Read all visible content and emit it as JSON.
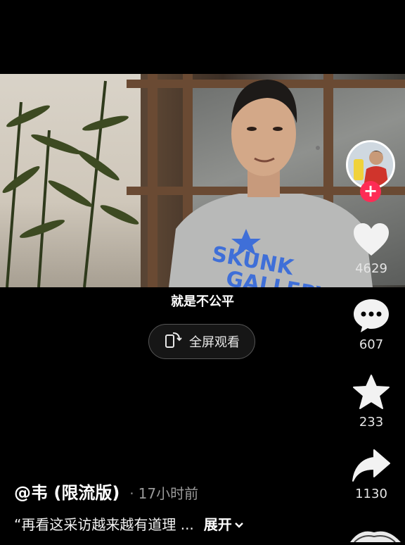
{
  "video": {
    "subtitle": "就是不公平"
  },
  "fullscreen": {
    "label": "全屏观看"
  },
  "actions": {
    "likes": "4629",
    "comments": "607",
    "favorites": "233",
    "shares": "1130"
  },
  "post": {
    "author": "@韦 (限流版)",
    "separator": "·",
    "time": "17小时前",
    "caption": "“再看这采访越来越有道理 ...",
    "expand_label": "展开"
  },
  "colors": {
    "background": "#000000",
    "follow_accent": "#fe2c55",
    "icon_white": "#f2f2f2"
  },
  "icons": [
    "heart-icon",
    "comment-icon",
    "star-icon",
    "share-icon",
    "rotate-screen-icon",
    "chevron-down-icon"
  ]
}
